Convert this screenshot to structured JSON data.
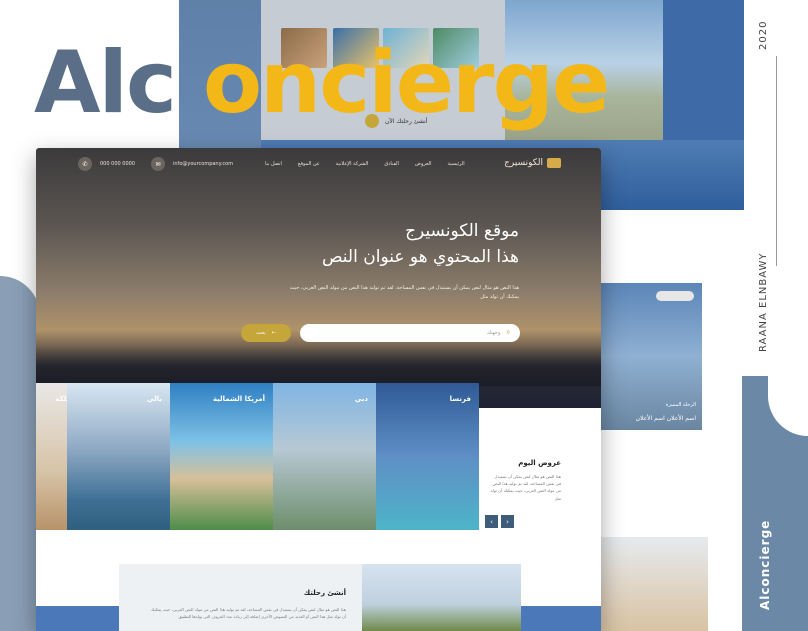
{
  "brand": {
    "part1": "Alc",
    "part2": "oncierge"
  },
  "right_texts": {
    "year": "2020",
    "author": "RAANA ELNBAWY",
    "name": "Alconcierge"
  },
  "back_mock": {
    "cta": "أنشئ رحلتك الآن"
  },
  "side_card": {
    "tag": "",
    "caption1": "الرحلة المميزة",
    "caption2": "اسم الأعلان اسم الأعلان"
  },
  "nav": {
    "logo": "الكونسيرج",
    "menu": [
      "الرئيسية",
      "العروض",
      "الفنادق",
      "الشركة الإعلانية",
      "عن الموقع",
      "اتصل بنا"
    ],
    "phone": "000 000 0000",
    "email": "info@yourcompany.com"
  },
  "hero": {
    "title_line1": "موقع الكونسيرج",
    "title_line2": "هذا المحتوي هو عنوان النص",
    "description": "هذا النص هو مثال لنص يمكن أن يستبدل في نفس المساحة، لقد تم توليد هذا النص من مولد النص العربى، حيث يمكنك أن تولد مثل",
    "search_placeholder": "وجهتك",
    "search_button": "بحث"
  },
  "destinations": [
    "فرنسا",
    "دبي",
    "أمريكا الشمالية",
    "بالي",
    "المملكة"
  ],
  "offers": {
    "title": "عروض اليوم",
    "text": "هذا النص هو مثال لنص يمكن أن يستبدل في نفس المساحة، لقد تم توليد هذا النص من مولد النص العربى، حيث يمكنك أن تولد مثل"
  },
  "trip": {
    "title": "أنشئ رحلتك",
    "text": "هذا النص هو مثال لنص يمكن أن يستبدل في نفس المساحة، لقد تم توليد هذا النص من مولد النص العربى، حيث يمكنك أن تولد مثل هذا النص أو العديد من النصوص الأخرى إضافة إلى زيادة عدد الحروف التى يولدها التطبيق"
  },
  "colors": {
    "accent": "#f3b817",
    "brand_gray": "#5a6f87",
    "gold": "#c5a63a",
    "navy": "#3d5d7b"
  }
}
